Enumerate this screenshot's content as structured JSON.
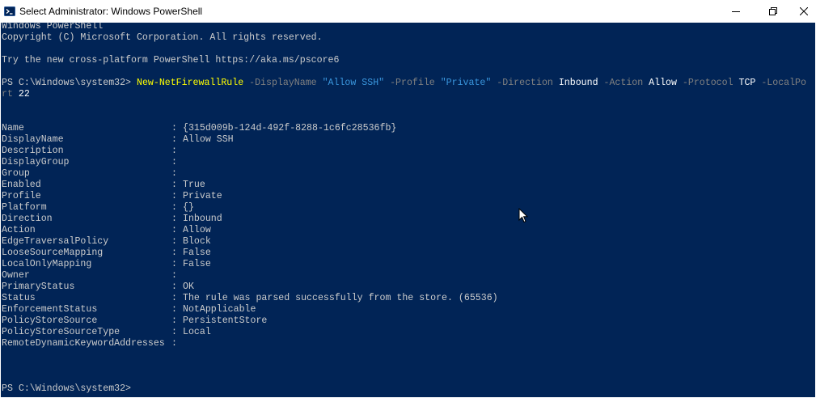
{
  "window": {
    "title": "Select Administrator: Windows PowerShell",
    "icons": {
      "app": "powershell-icon",
      "minimize": "minimize-icon",
      "maximize": "restore-icon",
      "close": "close-icon"
    }
  },
  "console": {
    "header": [
      "Windows PowerShell",
      "Copyright (C) Microsoft Corporation. All rights reserved.",
      "",
      "Try the new cross-platform PowerShell https://aka.ms/pscore6"
    ],
    "command": {
      "prompt": "PS C:\\Windows\\system32> ",
      "cmdlet": "New-NetFirewallRule",
      "p1": " -DisplayName ",
      "v1": "\"Allow SSH\"",
      "p2": " -Profile ",
      "v2": "\"Private\"",
      "p3": " -Direction ",
      "v3": "Inbound",
      "p4": " -Action ",
      "v4": "Allow",
      "p5": " -Protocol ",
      "v5": "TCP",
      "p6": " -LocalPo",
      "p6b": "rt",
      "v6": " 22"
    },
    "properties": [
      {
        "name": "Name",
        "value": "{315d009b-124d-492f-8288-1c6fc28536fb}"
      },
      {
        "name": "DisplayName",
        "value": "Allow SSH"
      },
      {
        "name": "Description",
        "value": ""
      },
      {
        "name": "DisplayGroup",
        "value": ""
      },
      {
        "name": "Group",
        "value": ""
      },
      {
        "name": "Enabled",
        "value": "True"
      },
      {
        "name": "Profile",
        "value": "Private"
      },
      {
        "name": "Platform",
        "value": "{}"
      },
      {
        "name": "Direction",
        "value": "Inbound"
      },
      {
        "name": "Action",
        "value": "Allow"
      },
      {
        "name": "EdgeTraversalPolicy",
        "value": "Block"
      },
      {
        "name": "LooseSourceMapping",
        "value": "False"
      },
      {
        "name": "LocalOnlyMapping",
        "value": "False"
      },
      {
        "name": "Owner",
        "value": ""
      },
      {
        "name": "PrimaryStatus",
        "value": "OK"
      },
      {
        "name": "Status",
        "value": "The rule was parsed successfully from the store. (65536)"
      },
      {
        "name": "EnforcementStatus",
        "value": "NotApplicable"
      },
      {
        "name": "PolicyStoreSource",
        "value": "PersistentStore"
      },
      {
        "name": "PolicyStoreSourceType",
        "value": "Local"
      },
      {
        "name": "RemoteDynamicKeywordAddresses",
        "value": ""
      }
    ],
    "separator": ":",
    "final_prompt": "PS C:\\Windows\\system32>",
    "colors": {
      "background": "#012456",
      "text": "#cccccc",
      "cmdlet": "#ffff00",
      "parameter": "#808080",
      "string": "#3a96dd",
      "argument": "#ffffff"
    }
  }
}
